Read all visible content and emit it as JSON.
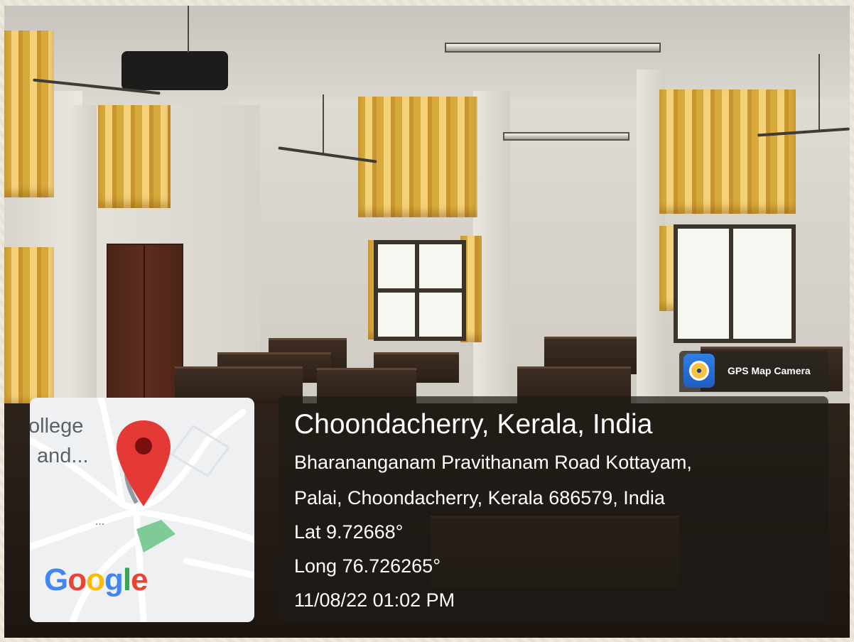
{
  "gps_badge": {
    "app_name": "GPS Map Camera",
    "icon": "gps-map-camera-icon"
  },
  "map": {
    "label_line_1": "ollege",
    "label_line_2": "and...",
    "dots": "...",
    "logo_letters": [
      {
        "char": "G",
        "color": "#4285F4"
      },
      {
        "char": "o",
        "color": "#EA4335"
      },
      {
        "char": "o",
        "color": "#FBBC05"
      },
      {
        "char": "g",
        "color": "#4285F4"
      },
      {
        "char": "l",
        "color": "#34A853"
      },
      {
        "char": "e",
        "color": "#EA4335"
      }
    ],
    "pin_color": "#E53935"
  },
  "location": {
    "title": "Choondacherry, Kerala, India",
    "address_line_1": "Bharananganam Pravithanam Road Kottayam,",
    "address_line_2": "Palai, Choondacherry, Kerala 686579, India",
    "latitude": "Lat 9.72668°",
    "longitude": "Long 76.726265°",
    "timestamp": "11/08/22 01:02 PM"
  }
}
